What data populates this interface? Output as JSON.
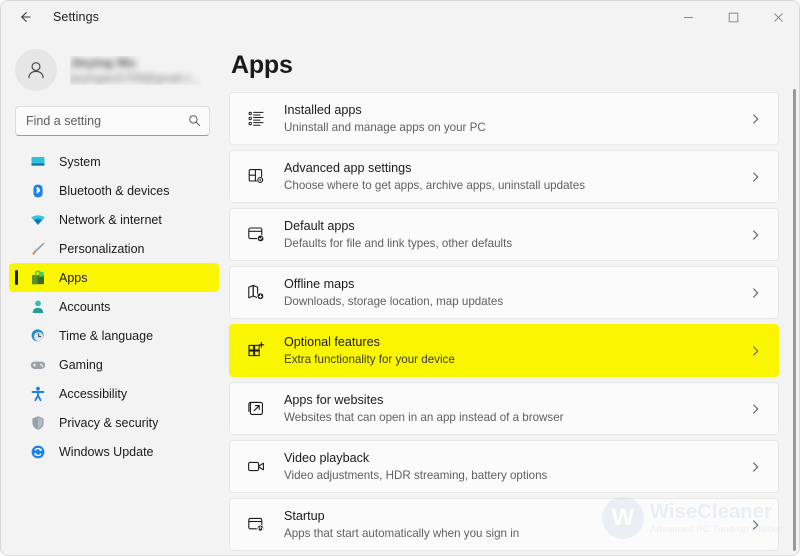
{
  "window": {
    "title": "Settings",
    "back_label": "Back",
    "minimize_label": "Minimize",
    "maximize_label": "Maximize",
    "close_label": "Close"
  },
  "account": {
    "name": "Jieying Wu",
    "email": "jieyingwu0709@gmail.c...",
    "avatar_icon": "person-icon"
  },
  "search": {
    "placeholder": "Find a setting",
    "value": "",
    "icon": "search-icon"
  },
  "sidebar": {
    "items": [
      {
        "label": "System",
        "icon": "monitor-icon",
        "selected": false,
        "highlighted": false
      },
      {
        "label": "Bluetooth & devices",
        "icon": "bluetooth-icon",
        "selected": false,
        "highlighted": false
      },
      {
        "label": "Network & internet",
        "icon": "wifi-icon",
        "selected": false,
        "highlighted": false
      },
      {
        "label": "Personalization",
        "icon": "paintbrush-icon",
        "selected": false,
        "highlighted": false
      },
      {
        "label": "Apps",
        "icon": "apps-bag-icon",
        "selected": true,
        "highlighted": true
      },
      {
        "label": "Accounts",
        "icon": "person-icon",
        "selected": false,
        "highlighted": false
      },
      {
        "label": "Time & language",
        "icon": "clock-icon",
        "selected": false,
        "highlighted": false
      },
      {
        "label": "Gaming",
        "icon": "gamepad-icon",
        "selected": false,
        "highlighted": false
      },
      {
        "label": "Accessibility",
        "icon": "accessibility-icon",
        "selected": false,
        "highlighted": false
      },
      {
        "label": "Privacy & security",
        "icon": "shield-icon",
        "selected": false,
        "highlighted": false
      },
      {
        "label": "Windows Update",
        "icon": "update-icon",
        "selected": false,
        "highlighted": false
      }
    ]
  },
  "main": {
    "page_title": "Apps",
    "cards": [
      {
        "title": "Installed apps",
        "subtitle": "Uninstall and manage apps on your PC",
        "icon": "list-icon",
        "highlighted": false
      },
      {
        "title": "Advanced app settings",
        "subtitle": "Choose where to get apps, archive apps, uninstall updates",
        "icon": "app-settings-icon",
        "highlighted": false
      },
      {
        "title": "Default apps",
        "subtitle": "Defaults for file and link types, other defaults",
        "icon": "default-apps-icon",
        "highlighted": false
      },
      {
        "title": "Offline maps",
        "subtitle": "Downloads, storage location, map updates",
        "icon": "map-icon",
        "highlighted": false
      },
      {
        "title": "Optional features",
        "subtitle": "Extra functionality for your device",
        "icon": "optional-features-icon",
        "highlighted": true
      },
      {
        "title": "Apps for websites",
        "subtitle": "Websites that can open in an app instead of a browser",
        "icon": "open-external-icon",
        "highlighted": false
      },
      {
        "title": "Video playback",
        "subtitle": "Video adjustments, HDR streaming, battery options",
        "icon": "video-camera-icon",
        "highlighted": false
      },
      {
        "title": "Startup",
        "subtitle": "Apps that start automatically when you sign in",
        "icon": "startup-icon",
        "highlighted": false
      }
    ]
  },
  "watermark": {
    "badge": "W",
    "name": "WiseCleaner",
    "tagline": "Advanced PC Tune-up Utilities"
  },
  "colors": {
    "highlight": "#faf600",
    "page_background": "#f3f3f3",
    "card_background": "#fbfbfb",
    "accent_blue": "#0078d4"
  }
}
